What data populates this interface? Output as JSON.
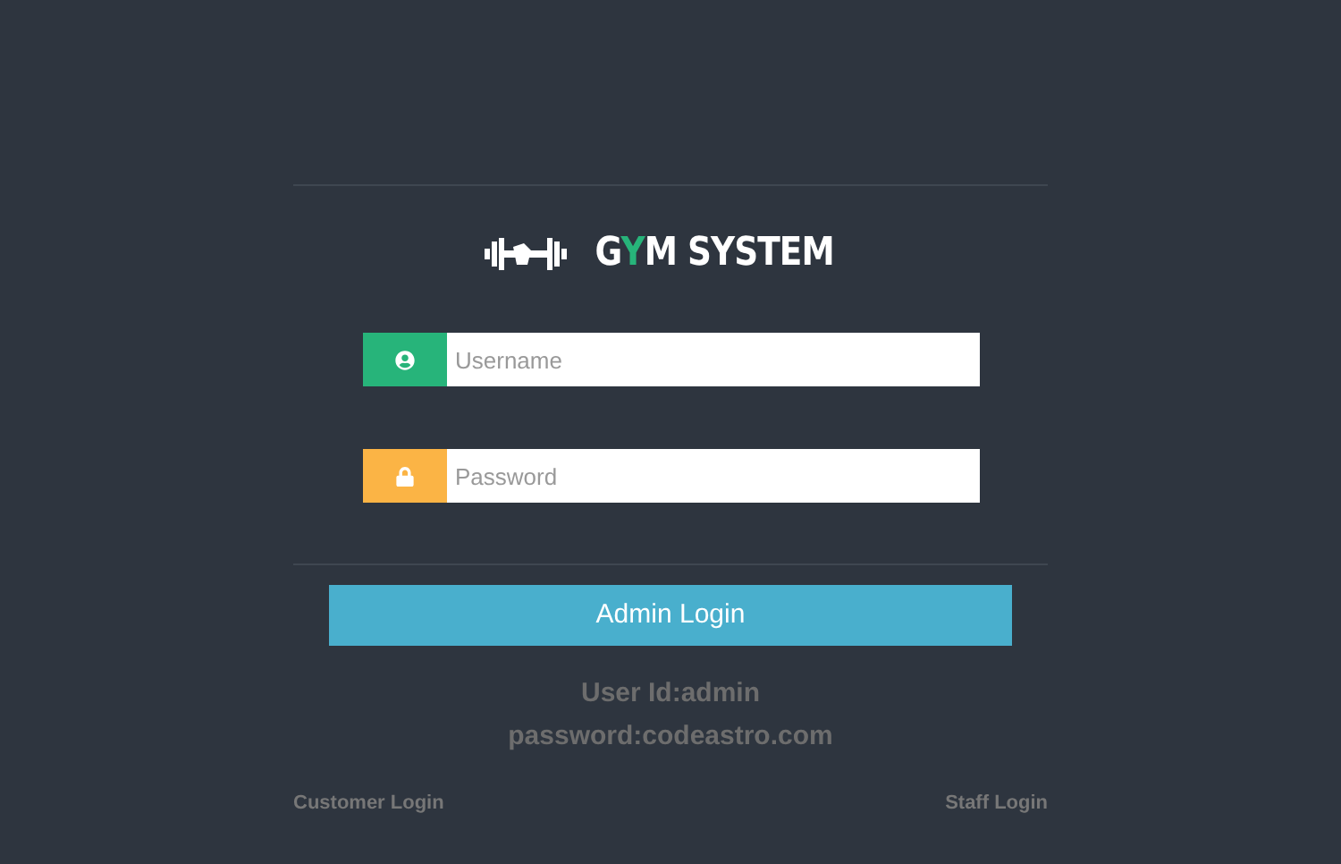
{
  "logo": {
    "parts": [
      {
        "text": "G",
        "accent": false
      },
      {
        "text": "Y",
        "accent": true
      },
      {
        "text": "M SYSTEM",
        "accent": false
      }
    ]
  },
  "fields": [
    {
      "kind": "user",
      "placeholder": "Username"
    },
    {
      "kind": "lock",
      "placeholder": "Password"
    }
  ],
  "login_button": "Admin Login",
  "credentials": [
    "User Id:admin",
    "password:codeastro.com"
  ],
  "links": [
    "Customer Login",
    "Staff Login"
  ]
}
